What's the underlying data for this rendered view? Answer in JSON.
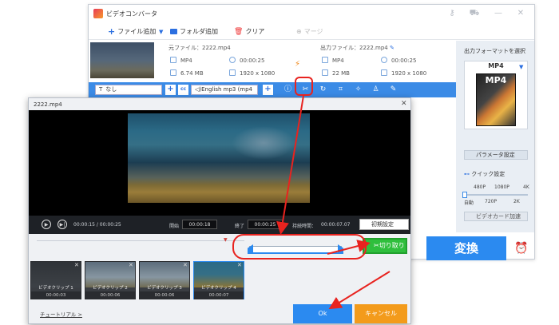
{
  "app": {
    "title": "ビデオコンバータ",
    "toolbar": {
      "add_file": "ファイル追加",
      "add_folder": "フォルダ追加",
      "clear": "クリア",
      "merge": "マージ"
    }
  },
  "file": {
    "source_name": "元ファイル：2222.mp4",
    "output_name": "出力ファイル：2222.mp4",
    "src_format": "MP4",
    "src_duration": "00:00:25",
    "src_size": "6.74 MB",
    "src_resolution": "1920 x 1080",
    "out_format": "MP4",
    "out_duration": "00:00:25",
    "out_size": "22 MB",
    "out_resolution": "1920 x 1080"
  },
  "edit_bar": {
    "subtitle_select": "なし",
    "audio_select": "English mp3 (mp4"
  },
  "right_panel": {
    "format_label": "出力フォーマットを選択",
    "format_value": "MP4",
    "param_button": "パラメータ設定",
    "quick_label": "クイック設定",
    "ticks_top": [
      "480P",
      "1080P",
      "4K"
    ],
    "ticks_bottom": [
      "自動",
      "720P",
      "2K"
    ],
    "gpu_label": "ビデオカード加速"
  },
  "convert_button": "変換",
  "trim_dialog": {
    "title": "2222.mp4",
    "time_display": "00:00:15 / 00:00:25",
    "start_label": "開始",
    "start_value": "00:00:18",
    "end_label": "終了",
    "end_value": "00:00:25",
    "duration_label": "持続時間：",
    "duration_value": "00:00:07.07",
    "reset_button": "初期設定",
    "cut_button": "切り取り",
    "clips": [
      {
        "label": "ビデオクリップ 1",
        "time": "00:00:03"
      },
      {
        "label": "ビデオクリップ 2",
        "time": "00:00:06"
      },
      {
        "label": "ビデオクリップ 3",
        "time": "00:00:06"
      },
      {
        "label": "ビデオクリップ 4",
        "time": "00:00:07"
      }
    ],
    "tutorial_link": "チュートリアル >",
    "ok_button": "Ok",
    "cancel_button": "キャンセル"
  },
  "colors": {
    "accent": "#2b8af0",
    "cut_green": "#2fbf3d",
    "cancel_orange": "#f39b1b",
    "annotation_red": "#e8231f"
  }
}
